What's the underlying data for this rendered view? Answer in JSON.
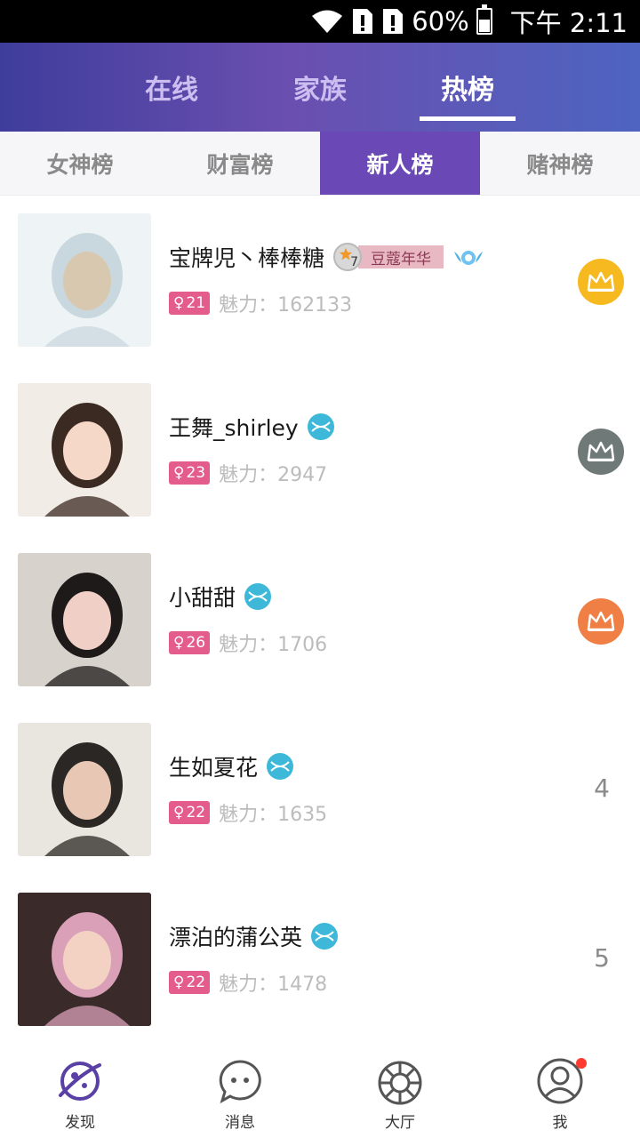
{
  "status_bar": {
    "battery_percent": "60%",
    "battery_level": 0.6,
    "time": "下午 2:11"
  },
  "top_tabs": [
    {
      "label": "在线",
      "active": false
    },
    {
      "label": "家族",
      "active": false
    },
    {
      "label": "热榜",
      "active": true
    }
  ],
  "sub_tabs": [
    {
      "label": "女神榜",
      "active": false
    },
    {
      "label": "财富榜",
      "active": false
    },
    {
      "label": "新人榜",
      "active": true
    },
    {
      "label": "赌神榜",
      "active": false
    }
  ],
  "rankings": [
    {
      "name": "宝牌児丶棒棒糖",
      "age": "21",
      "charm": "魅力：162133",
      "rank": "1",
      "crown_color": "#f6b920",
      "level": "7",
      "family": "豆蔻年华",
      "avatar_colors": [
        "#eef3f5",
        "#c9d8de",
        "#d9c8b0"
      ]
    },
    {
      "name": "王舞_shirley",
      "age": "23",
      "charm": "魅力：2947",
      "rank": "2",
      "crown_color": "#6f7a78",
      "avatar_colors": [
        "#f2ece6",
        "#3b2a22",
        "#f5d8c8"
      ]
    },
    {
      "name": "小甜甜",
      "age": "26",
      "charm": "魅力：1706",
      "rank": "3",
      "crown_color": "#ef7f45",
      "avatar_colors": [
        "#d8d2cc",
        "#1e1a1a",
        "#f0d0c6"
      ]
    },
    {
      "name": "生如夏花",
      "age": "22",
      "charm": "魅力：1635",
      "rank": "4",
      "avatar_colors": [
        "#e9e6e0",
        "#2b2724",
        "#e8c8b4"
      ]
    },
    {
      "name": "漂泊的蒲公英",
      "age": "22",
      "charm": "魅力：1478",
      "rank": "5",
      "avatar_colors": [
        "#3a2a2a",
        "#d9a0b8",
        "#f3d2c4"
      ]
    }
  ],
  "bottom_nav": [
    {
      "label": "发现",
      "icon": "planet-icon",
      "active": true
    },
    {
      "label": "消息",
      "icon": "chat-bubble-icon",
      "active": false
    },
    {
      "label": "大厅",
      "icon": "wheel-icon",
      "active": false
    },
    {
      "label": "我",
      "icon": "user-icon",
      "active": false,
      "notification": true
    }
  ],
  "colors": {
    "accent": "#6a48b5",
    "age_tag": "#e35c8c",
    "vip_badge": "#3db8d9"
  }
}
